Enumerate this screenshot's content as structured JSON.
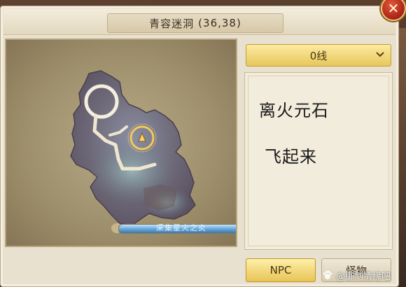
{
  "window": {
    "title_prefix": "青容迷洞",
    "coords": "(36,38)",
    "close_glyph": "✕"
  },
  "map": {
    "progress": {
      "label": "采集星火之炎",
      "fraction": 0.78
    }
  },
  "line_select": {
    "value": "0线",
    "icon": "chevron-down-icon"
  },
  "note": {
    "line1": "离火元石",
    "line2": "飞起来"
  },
  "tabs": {
    "npc": "NPC",
    "monster": "怪物"
  },
  "watermark": {
    "text": "@御剑情缘吧"
  },
  "colors": {
    "accent_gold": "#e8c456",
    "panel": "#e9e1cf",
    "close_red": "#b2281a",
    "progress_blue": "#6aa8d8"
  }
}
